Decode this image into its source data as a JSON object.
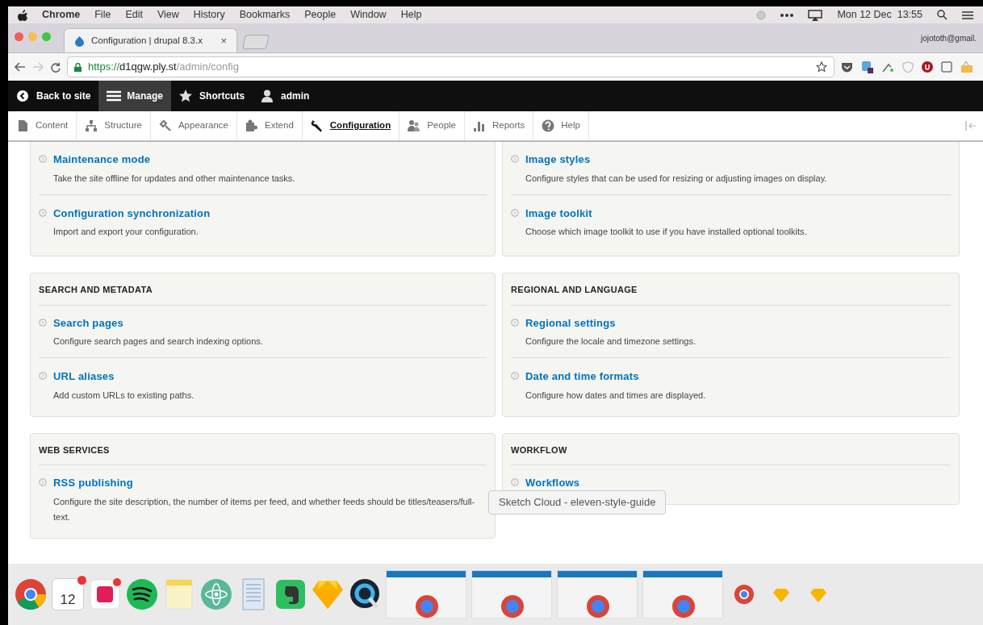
{
  "menubar": {
    "app": "Chrome",
    "items": [
      "File",
      "Edit",
      "View",
      "History",
      "Bookmarks",
      "People",
      "Window",
      "Help"
    ],
    "clock": "Mon 12 Dec  13:55"
  },
  "browser_tab": {
    "title": "Configuration | drupal 8.3.x",
    "close": "×"
  },
  "profile": "jojototh@gmail.",
  "address": {
    "scheme": "https://",
    "host": "d1qgw.ply.st",
    "path": "/admin/config"
  },
  "toolbar": [
    {
      "label": "Back to site",
      "kind": "back",
      "selected": false
    },
    {
      "label": "Manage",
      "kind": "menu",
      "selected": true
    },
    {
      "label": "Shortcuts",
      "kind": "star",
      "selected": false
    },
    {
      "label": "admin",
      "kind": "user",
      "selected": false
    }
  ],
  "tray": [
    {
      "label": "Content",
      "kind": "document",
      "selected": false
    },
    {
      "label": "Structure",
      "kind": "hierarchy",
      "selected": false
    },
    {
      "label": "Appearance",
      "kind": "brush",
      "selected": false
    },
    {
      "label": "Extend",
      "kind": "puzzle",
      "selected": false
    },
    {
      "label": "Configuration",
      "kind": "wrench",
      "selected": true
    },
    {
      "label": "People",
      "kind": "people",
      "selected": false
    },
    {
      "label": "Reports",
      "kind": "bars",
      "selected": false
    },
    {
      "label": "Help",
      "kind": "help",
      "selected": false
    }
  ],
  "columns": [
    [
      {
        "items": [
          {
            "title": "Maintenance mode",
            "description": "Take the site offline for updates and other maintenance tasks."
          },
          {
            "title": "Configuration synchronization",
            "description": "Import and export your configuration."
          }
        ]
      },
      {
        "heading": "SEARCH AND METADATA",
        "items": [
          {
            "title": "Search pages",
            "description": "Configure search pages and search indexing options."
          },
          {
            "title": "URL aliases",
            "description": "Add custom URLs to existing paths."
          }
        ]
      },
      {
        "heading": "WEB SERVICES",
        "items": [
          {
            "title": "RSS publishing",
            "description": "Configure the site description, the number of items per feed, and whether feeds should be titles/teasers/full-text."
          }
        ]
      }
    ],
    [
      {
        "items": [
          {
            "title": "Image styles",
            "description": "Configure styles that can be used for resizing or adjusting images on display."
          },
          {
            "title": "Image toolkit",
            "description": "Choose which image toolkit to use if you have installed optional toolkits."
          }
        ]
      },
      {
        "heading": "REGIONAL AND LANGUAGE",
        "items": [
          {
            "title": "Regional settings",
            "description": "Configure the locale and timezone settings."
          },
          {
            "title": "Date and time formats",
            "description": "Configure how dates and times are displayed."
          }
        ]
      },
      {
        "heading": "WORKFLOW",
        "items": [
          {
            "title": "Workflows"
          }
        ]
      }
    ]
  ],
  "tooltip": "Sketch Cloud - eleven-style-guide",
  "dock": [
    {
      "kind": "chrome"
    },
    {
      "kind": "calendar",
      "text": "12"
    },
    {
      "kind": "slack"
    },
    {
      "kind": "spotify"
    },
    {
      "kind": "notes"
    },
    {
      "kind": "atom"
    },
    {
      "kind": "textedit"
    },
    {
      "kind": "evernote"
    },
    {
      "kind": "sketch"
    },
    {
      "kind": "quicktime"
    },
    {
      "kind": "window"
    },
    {
      "kind": "window"
    },
    {
      "kind": "window"
    },
    {
      "kind": "window"
    },
    {
      "kind": "minichrome"
    },
    {
      "kind": "minisketch"
    },
    {
      "kind": "minisketch"
    }
  ]
}
